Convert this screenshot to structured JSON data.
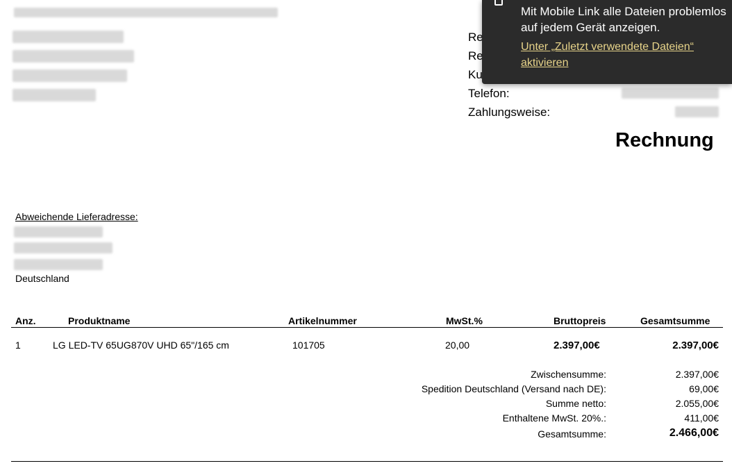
{
  "customer_info": {
    "labels": [
      "Re",
      "Re",
      "Ku",
      "Telefon:",
      "Zahlungsweise:"
    ]
  },
  "document": {
    "title": "Rechnung"
  },
  "delivery": {
    "heading": "Abweichende Lieferadresse:",
    "country": "Deutschland"
  },
  "table": {
    "headers": [
      "Anz.",
      "Produktname",
      "Artikelnummer",
      "MwSt.%",
      "Bruttopreis",
      "Gesamtsumme"
    ],
    "rows": [
      {
        "qty": "1",
        "product": "LG LED-TV 65UG870V UHD 65\"/165 cm",
        "article": "101705",
        "vat": "20,00",
        "gross": "2.397,00€",
        "total": "2.397,00€"
      }
    ]
  },
  "totals": [
    {
      "label": "Zwischensumme:",
      "value": "2.397,00€"
    },
    {
      "label": "Spedition Deutschland (Versand nach DE):",
      "value": "69,00€"
    },
    {
      "label": "Summe netto:",
      "value": "2.055,00€"
    },
    {
      "label": "Enthaltene MwSt. 20%.:",
      "value": "411,00€"
    },
    {
      "label": "Gesamtsumme:",
      "value": "2.466,00€"
    }
  ],
  "notification": {
    "message": "Mit Mobile Link alle Dateien problemlos auf jedem Gerät anzeigen.",
    "link": "Unter „Zuletzt verwendete Dateien“ aktivieren"
  }
}
